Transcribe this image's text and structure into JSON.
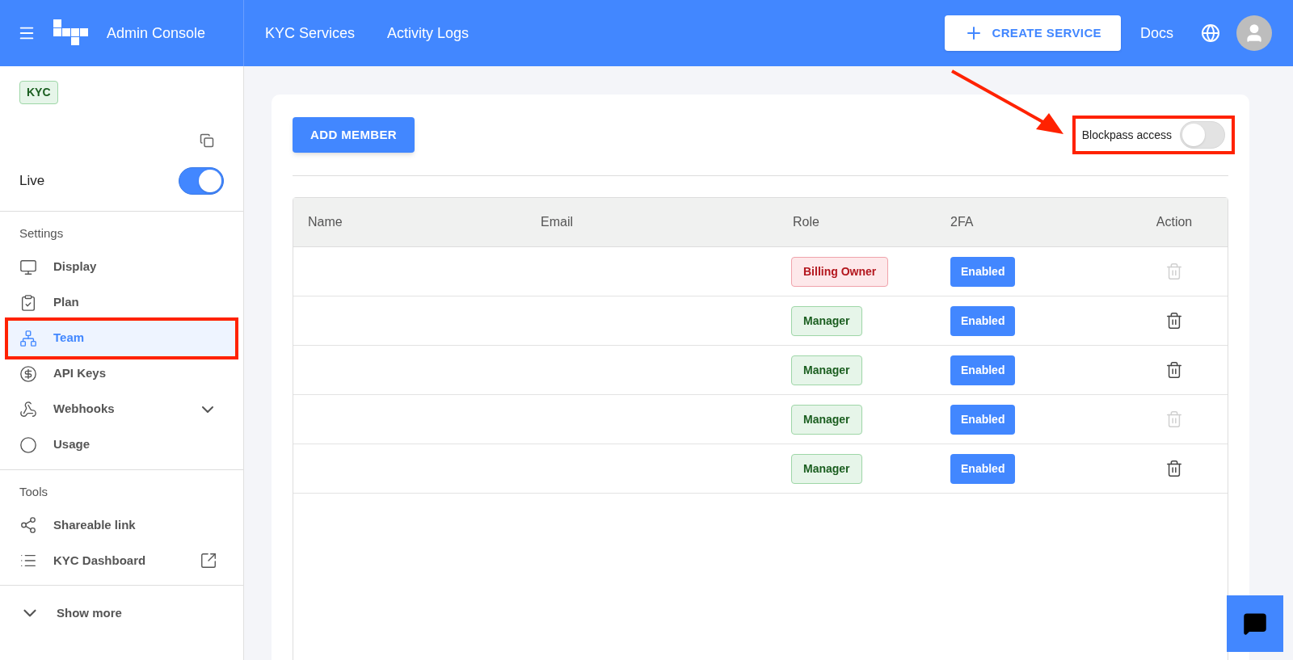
{
  "header": {
    "title": "Admin Console",
    "nav": [
      "KYC Services",
      "Activity Logs"
    ],
    "create_button": "CREATE SERVICE",
    "docs": "Docs"
  },
  "sidebar": {
    "badge": "KYC",
    "live": {
      "label": "Live",
      "on": true
    },
    "sections": [
      {
        "title": "Settings",
        "items": [
          {
            "label": "Display",
            "kind": "link",
            "selected": false
          },
          {
            "label": "Plan",
            "kind": "link",
            "selected": false
          },
          {
            "label": "Team",
            "kind": "link",
            "selected": true
          },
          {
            "label": "API Keys",
            "kind": "link",
            "selected": false
          },
          {
            "label": "Webhooks",
            "kind": "expandable",
            "selected": false
          },
          {
            "label": "Usage",
            "kind": "link",
            "selected": false
          }
        ]
      },
      {
        "title": "Tools",
        "items": [
          {
            "label": "Shareable link",
            "kind": "link",
            "selected": false
          },
          {
            "label": "KYC Dashboard",
            "kind": "external",
            "selected": false
          }
        ]
      }
    ],
    "show_more": "Show more"
  },
  "content": {
    "add_button": "ADD MEMBER",
    "blockpass": {
      "label": "Blockpass access",
      "on": false
    },
    "table": {
      "columns": [
        "Name",
        "Email",
        "Role",
        "2FA",
        "Action"
      ],
      "rows": [
        {
          "role": "Billing Owner",
          "kind": "owner",
          "twofa": "Enabled",
          "delete_disabled": true
        },
        {
          "role": "Manager",
          "kind": "manager",
          "twofa": "Enabled",
          "delete_disabled": false
        },
        {
          "role": "Manager",
          "kind": "manager",
          "twofa": "Enabled",
          "delete_disabled": false
        },
        {
          "role": "Manager",
          "kind": "manager",
          "twofa": "Enabled",
          "delete_disabled": true
        },
        {
          "role": "Manager",
          "kind": "manager",
          "twofa": "Enabled",
          "delete_disabled": false
        }
      ]
    }
  }
}
